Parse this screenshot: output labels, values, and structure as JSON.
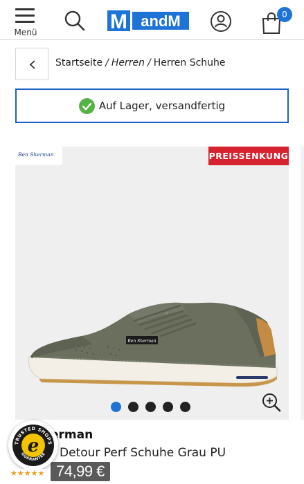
{
  "header": {
    "menu_label": "Menü",
    "logo_text_m": "M",
    "logo_text_rest": "andM",
    "cart_count": "0",
    "accent_color": "#1d73d6"
  },
  "breadcrumb": {
    "items": [
      "Startseite",
      "Herren",
      "Herren Schuhe"
    ],
    "separator": "/"
  },
  "stock": {
    "text": "Auf Lager, versandfertig",
    "icon": "check-icon",
    "color": "#56b345"
  },
  "product": {
    "brand_logo_text": "Ben Sherman",
    "badge": "PREISSENKUNG",
    "badge_color": "#d6232f",
    "shoe_tag_text": "Ben Sherman",
    "brand_partial": "erman",
    "name_partial": "Detour Perf Schuhe Grau PU",
    "price": "74,99 €",
    "gallery_dots": 5,
    "active_dot": 0
  },
  "trust": {
    "badge_text_top": "TRUSTED SHOPS",
    "badge_text_bottom": "GUARANTEE",
    "badge_letter": "e",
    "stars": "★★★★★"
  }
}
